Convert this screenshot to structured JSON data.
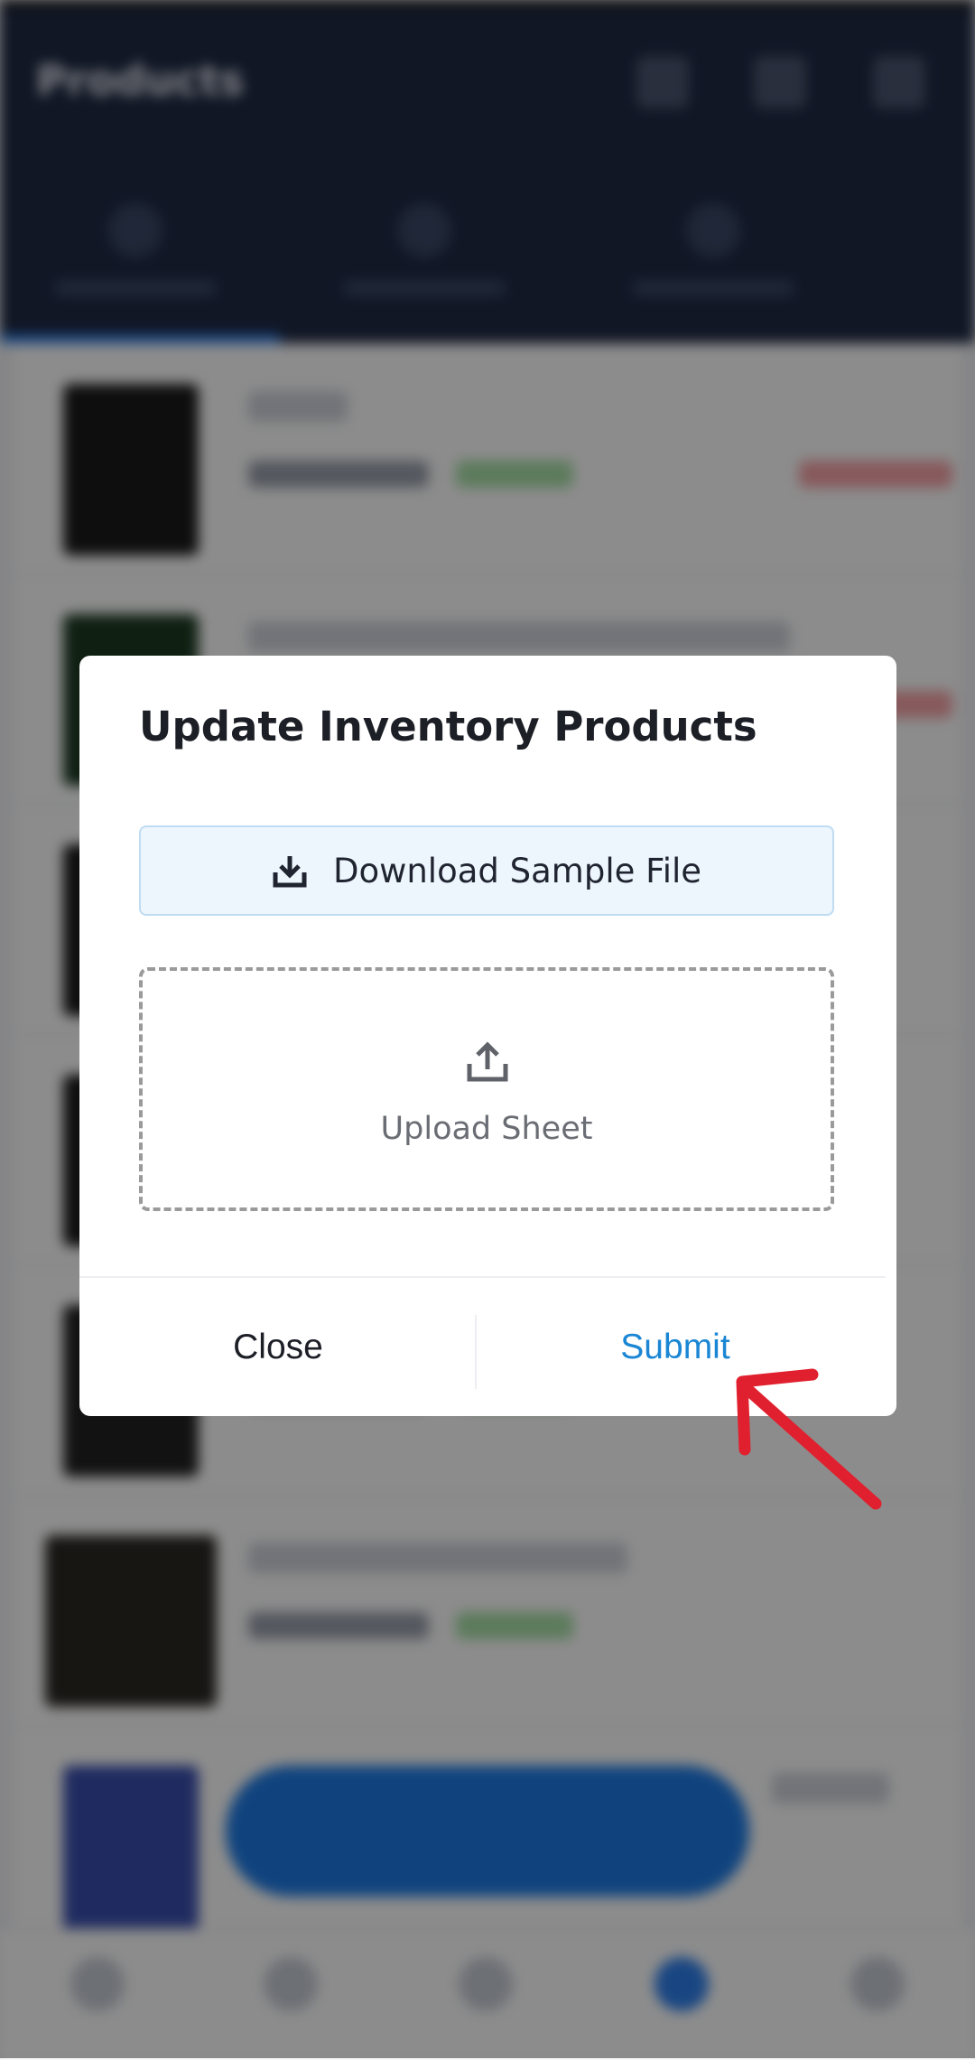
{
  "background": {
    "app_title": "Products"
  },
  "dialog": {
    "title": "Update Inventory Products",
    "download_button_label": "Download Sample File",
    "download_icon": "download-icon",
    "upload_label": "Upload Sheet",
    "upload_icon": "upload-icon",
    "close_label": "Close",
    "submit_label": "Submit"
  },
  "colors": {
    "submit_accent": "#1a86d4",
    "download_bg": "#eef6fd",
    "annotation_arrow": "#e0202e"
  }
}
